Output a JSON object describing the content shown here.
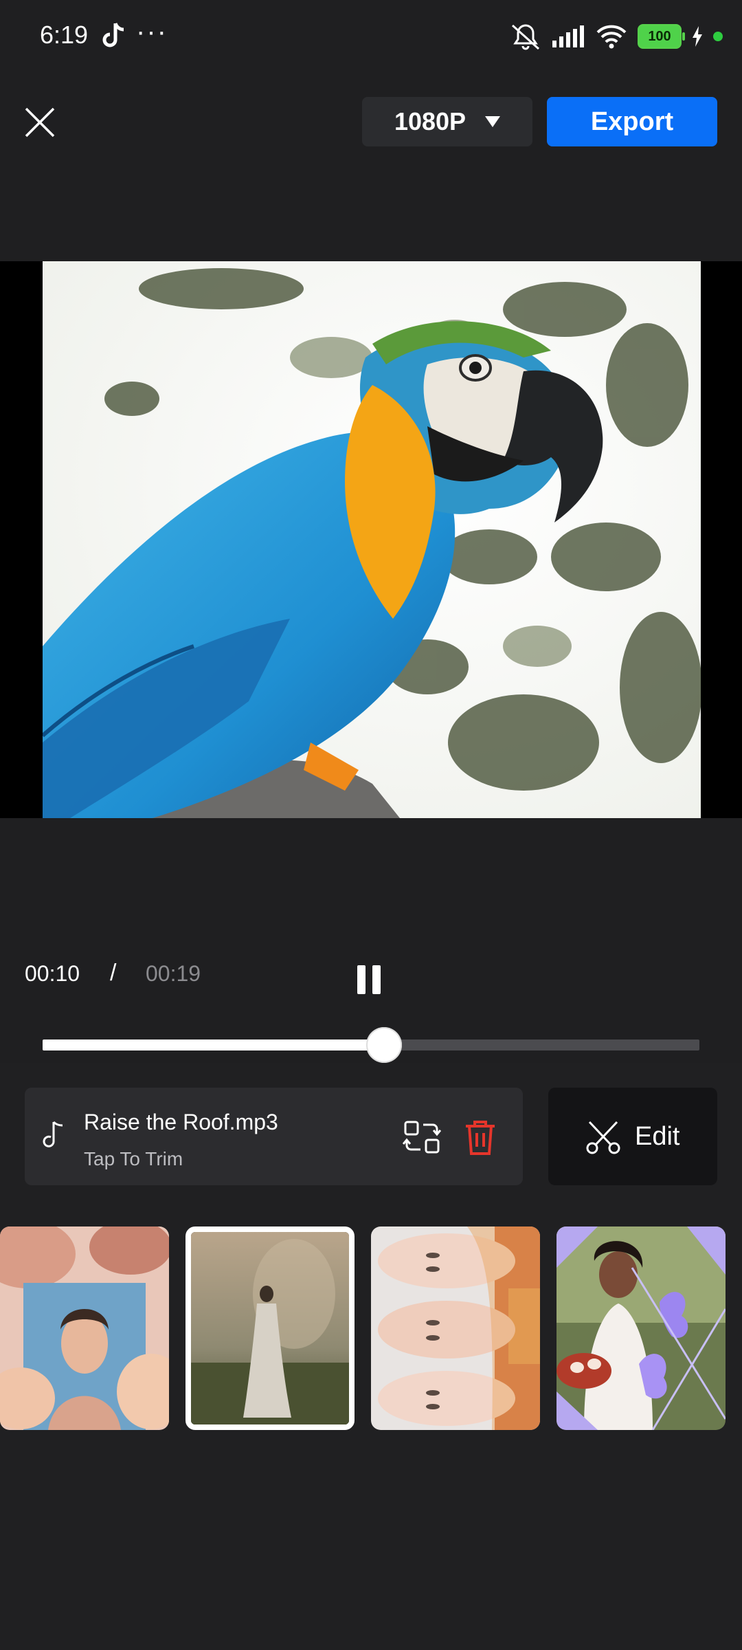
{
  "status_bar": {
    "time": "6:19",
    "dots": "···",
    "battery": "100"
  },
  "top_bar": {
    "resolution": "1080P",
    "export_label": "Export"
  },
  "playback": {
    "current_time": "00:10",
    "separator": "/",
    "total_time": "00:19",
    "progress": 0.52
  },
  "music": {
    "title": "Raise the Roof.mp3",
    "subtitle": "Tap To Trim"
  },
  "edit_label": "Edit",
  "thumbnails": [
    {
      "name": "clip-woman-flowers",
      "selected": false
    },
    {
      "name": "clip-woman-field",
      "selected": true
    },
    {
      "name": "clip-three-faces",
      "selected": false
    },
    {
      "name": "clip-bride-butterflies",
      "selected": false
    }
  ],
  "colors": {
    "background": "#1f1f21",
    "accent": "#0a6ff7",
    "delete": "#e5352b",
    "battery": "#4fd24a"
  }
}
